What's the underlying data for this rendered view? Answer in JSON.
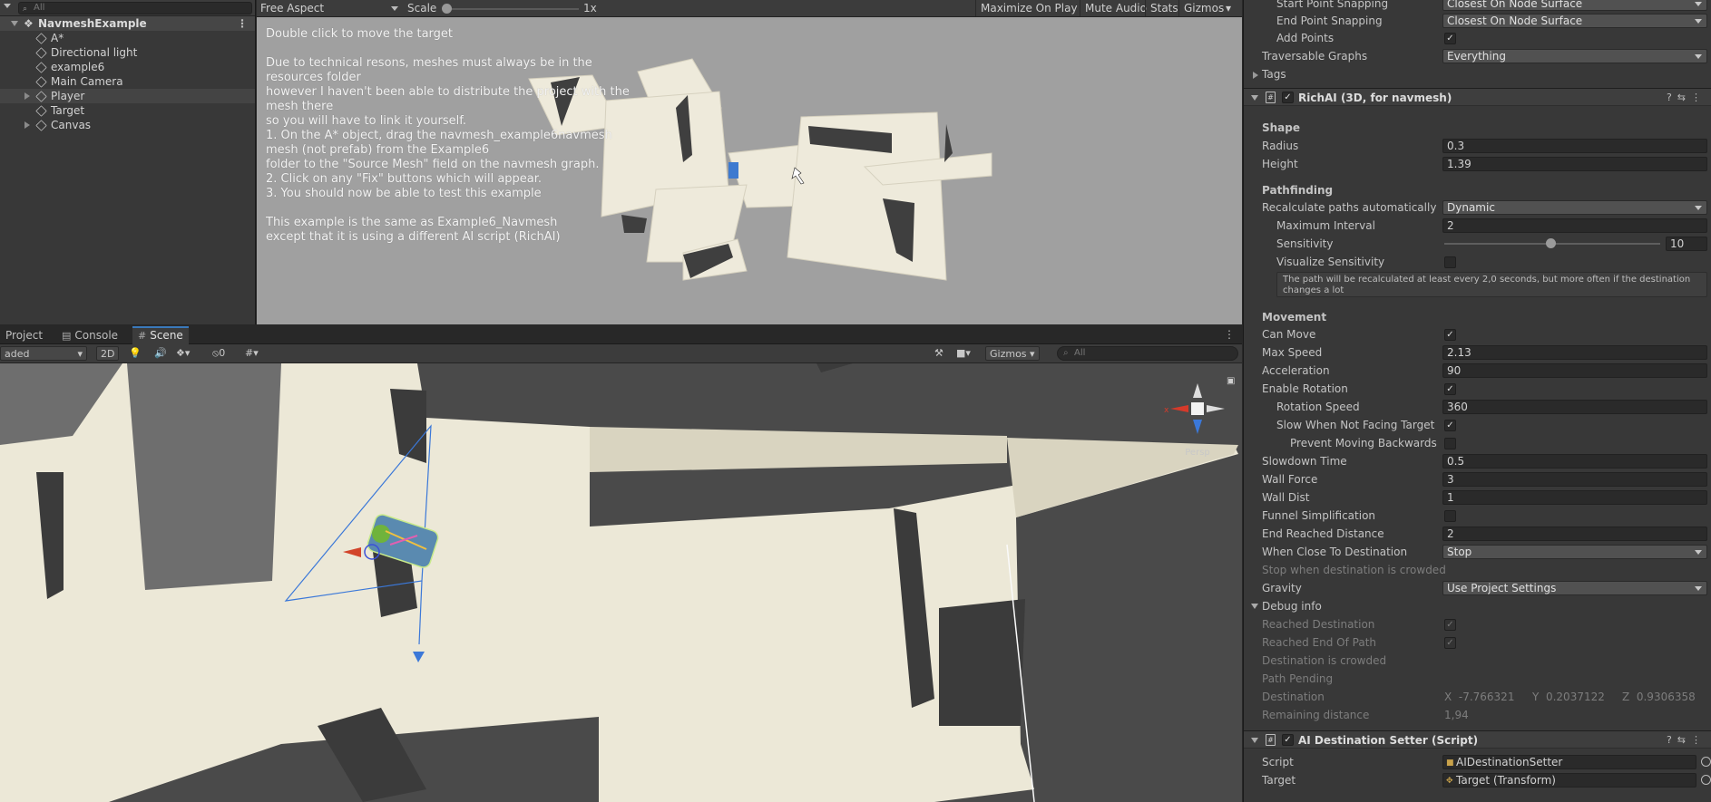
{
  "hierarchy": {
    "search_placeholder": "All",
    "scene_name": "NavmeshExample",
    "items": [
      {
        "label": "A*"
      },
      {
        "label": "Directional light"
      },
      {
        "label": "example6"
      },
      {
        "label": "Main Camera"
      },
      {
        "label": "Player"
      },
      {
        "label": "Target"
      },
      {
        "label": "Canvas"
      }
    ]
  },
  "game": {
    "aspect": "Free Aspect",
    "scale_label": "Scale",
    "scale_value": "1x",
    "buttons": [
      "Maximize On Play",
      "Mute Audio",
      "Stats",
      "Gizmos"
    ],
    "instructions": "Double click to move the target\n\nDue to technical resons, meshes must always be in the\nresources folder\nhowever I haven't been able to distribute the project with the\nmesh there\nso you will have to link it yourself.\n1. On the A* object, drag the navmesh_example6navmesh\nmesh (not prefab) from the Example6\nfolder to the \"Source Mesh\" field on the navmesh graph.\n2. Click on any \"Fix\" buttons which will appear.\n3. You should now be able to test this example\n\nThis example is the same as Example6_Navmesh\nexcept that it is using a different AI script (RichAI)"
  },
  "tabs": {
    "project": "Project",
    "console": "Console",
    "scene": "Scene"
  },
  "scene_toolbar": {
    "shading": "aded",
    "mode_2d": "2D",
    "hidden_count": "0",
    "gizmos": "Gizmos",
    "search_placeholder": "All",
    "persp": "Persp"
  },
  "inspector": {
    "top_rows": [
      {
        "label": "Start Point Snapping",
        "value": "Closest On Node Surface"
      },
      {
        "label": "End Point Snapping",
        "value": "Closest On Node Surface"
      },
      {
        "label": "Add Points",
        "check": "✓"
      },
      {
        "label": "Traversable Graphs",
        "value": "Everything"
      },
      {
        "label": "Tags"
      }
    ],
    "richai": {
      "title": "RichAI (3D, for navmesh)",
      "shape_header": "Shape",
      "radius_label": "Radius",
      "radius": "0.3",
      "height_label": "Height",
      "height": "1.39",
      "pathfinding_header": "Pathfinding",
      "recalc_label": "Recalculate paths automatically",
      "recalc": "Dynamic",
      "max_interval_label": "Maximum Interval",
      "max_interval": "2",
      "sensitivity_label": "Sensitivity",
      "sensitivity": "10",
      "visualize_label": "Visualize Sensitivity",
      "help": "The path will be recalculated at least every 2,0 seconds, but more often if the destination changes a lot",
      "movement_header": "Movement",
      "can_move_label": "Can Move",
      "max_speed_label": "Max Speed",
      "max_speed": "2.13",
      "acceleration_label": "Acceleration",
      "acceleration": "90",
      "enable_rotation_label": "Enable Rotation",
      "rotation_speed_label": "Rotation Speed",
      "rotation_speed": "360",
      "slow_label": "Slow When Not Facing Target",
      "prevent_label": "Prevent Moving Backwards",
      "slowdown_label": "Slowdown Time",
      "slowdown": "0.5",
      "wall_force_label": "Wall Force",
      "wall_force": "3",
      "wall_dist_label": "Wall Dist",
      "wall_dist": "1",
      "funnel_label": "Funnel Simplification",
      "end_reached_label": "End Reached Distance",
      "end_reached": "2",
      "when_close_label": "When Close To Destination",
      "when_close": "Stop",
      "stop_crowded_label": "Stop when destination is crowded",
      "gravity_label": "Gravity",
      "gravity": "Use Project Settings",
      "debug_header": "Debug info",
      "reached_dest_label": "Reached Destination",
      "reached_end_label": "Reached End Of Path",
      "dest_crowded_label": "Destination is crowded",
      "path_pending_label": "Path Pending",
      "destination_label": "Destination",
      "dest_x": "-7.766321",
      "dest_y": "0.2037122",
      "dest_z": "0.9306358",
      "remaining_label": "Remaining distance",
      "remaining": "1,94"
    },
    "setter": {
      "title": "AI Destination Setter (Script)",
      "script_label": "Script",
      "script": "AIDestinationSetter",
      "target_label": "Target",
      "target": "Target (Transform)"
    },
    "check_mark": "✓"
  }
}
